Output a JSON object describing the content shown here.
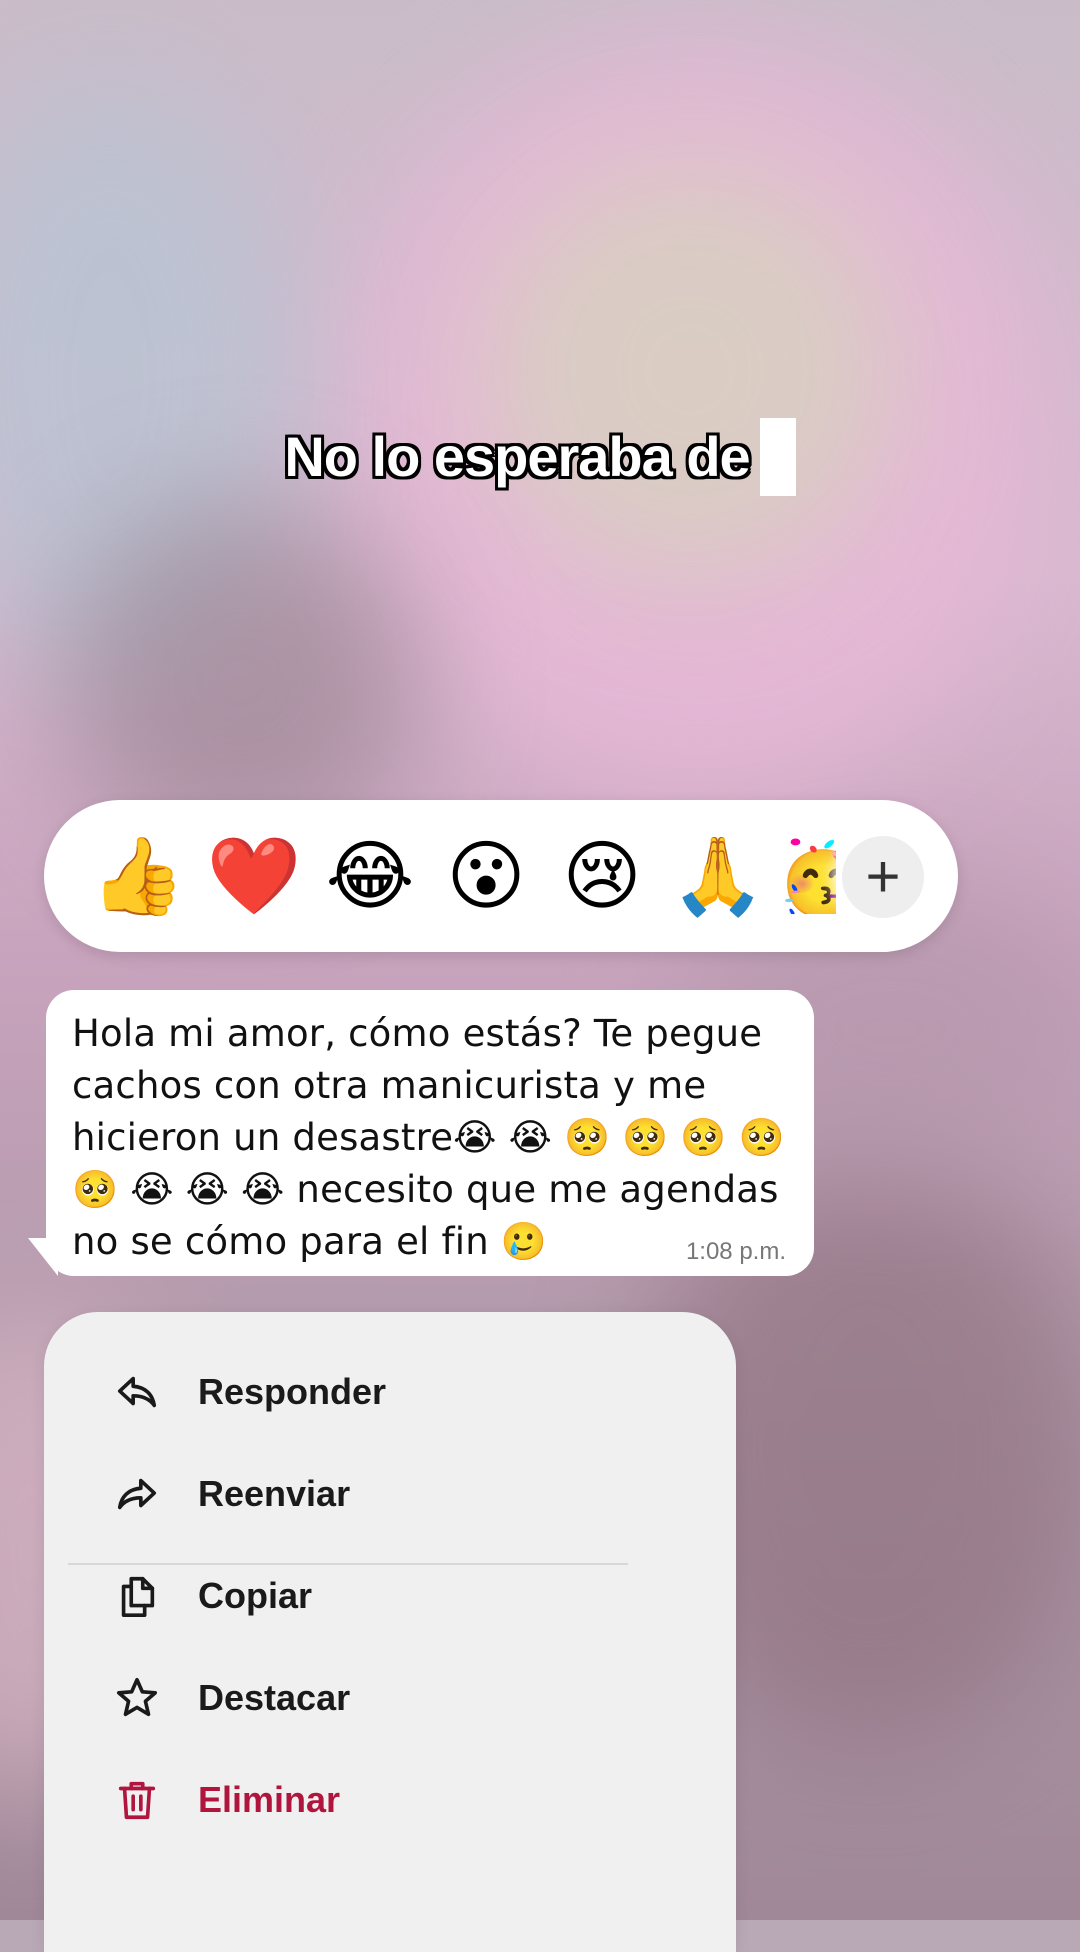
{
  "caption": {
    "text": "No lo esperaba de"
  },
  "reactions": {
    "emojis": [
      {
        "icon": "thumbs-up",
        "glyph": "👍"
      },
      {
        "icon": "red-heart",
        "glyph": "❤️"
      },
      {
        "icon": "face-with-tears-of-joy",
        "glyph": "😂"
      },
      {
        "icon": "face-with-open-mouth",
        "glyph": "😮"
      },
      {
        "icon": "crying-face",
        "glyph": "😢"
      },
      {
        "icon": "folded-hands",
        "glyph": "🙏"
      },
      {
        "icon": "partying-face",
        "glyph": "🥳"
      }
    ],
    "more": "+"
  },
  "message": {
    "text": "Hola mi amor, cómo estás? Te pegue cachos con otra manicurista y me hicieron un desastre😭 😭 🥺 🥺 🥺 🥺 🥺 😭 😭 😭  necesito que me agendas no se cómo para el fin 🥲",
    "time": "1:08 p.m."
  },
  "menu": {
    "items": [
      {
        "label": "Responder",
        "icon": "reply-icon"
      },
      {
        "label": "Reenviar",
        "icon": "forward-icon"
      },
      {
        "label": "Copiar",
        "icon": "copy-icon"
      },
      {
        "label": "Destacar",
        "icon": "star-icon"
      },
      {
        "label": "Eliminar",
        "icon": "trash-icon",
        "color": "#b0153e"
      }
    ]
  }
}
